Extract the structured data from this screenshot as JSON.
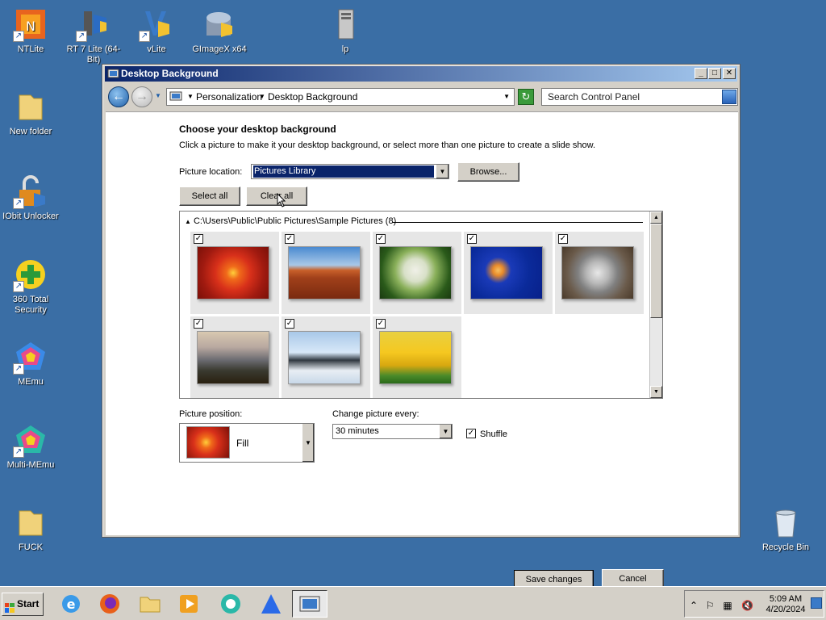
{
  "desktop": {
    "icons": [
      {
        "label": "NTLite"
      },
      {
        "label": "RT 7 Lite (64-Bit)"
      },
      {
        "label": "vLite"
      },
      {
        "label": "GImageX x64"
      },
      {
        "label": "lp"
      },
      {
        "label": "New folder"
      },
      {
        "label": "IObit Unlocker"
      },
      {
        "label": "360 Total Security"
      },
      {
        "label": "MEmu"
      },
      {
        "label": "Multi-MEmu"
      },
      {
        "label": "FUCK"
      },
      {
        "label": "Recycle Bin"
      }
    ]
  },
  "window": {
    "title": "Desktop Background",
    "breadcrumbs": [
      "Personalization",
      "Desktop Background"
    ],
    "search_placeholder": "Search Control Panel",
    "heading": "Choose your desktop background",
    "subheading": "Click a picture to make it your desktop background, or select more than one picture to create a slide show.",
    "picture_location_label": "Picture location:",
    "picture_location_value": "Pictures Library",
    "browse_label": "Browse...",
    "select_all_label": "Select all",
    "clear_all_label": "Clear all",
    "gallery_group": "C:\\Users\\Public\\Public Pictures\\Sample Pictures (8)",
    "pictures": [
      {
        "name": "chrysanthemum",
        "checked": true
      },
      {
        "name": "desert",
        "checked": true
      },
      {
        "name": "hydrangeas",
        "checked": true
      },
      {
        "name": "jellyfish",
        "checked": true
      },
      {
        "name": "koala",
        "checked": true
      },
      {
        "name": "lighthouse",
        "checked": true
      },
      {
        "name": "penguins",
        "checked": true
      },
      {
        "name": "tulips",
        "checked": true
      }
    ],
    "picture_position_label": "Picture position:",
    "picture_position_value": "Fill",
    "change_every_label": "Change picture every:",
    "change_every_value": "30 minutes",
    "shuffle_label": "Shuffle",
    "shuffle_checked": true,
    "save_label": "Save changes",
    "cancel_label": "Cancel"
  },
  "taskbar": {
    "start_label": "Start",
    "time": "5:09 AM",
    "date": "4/20/2024"
  }
}
